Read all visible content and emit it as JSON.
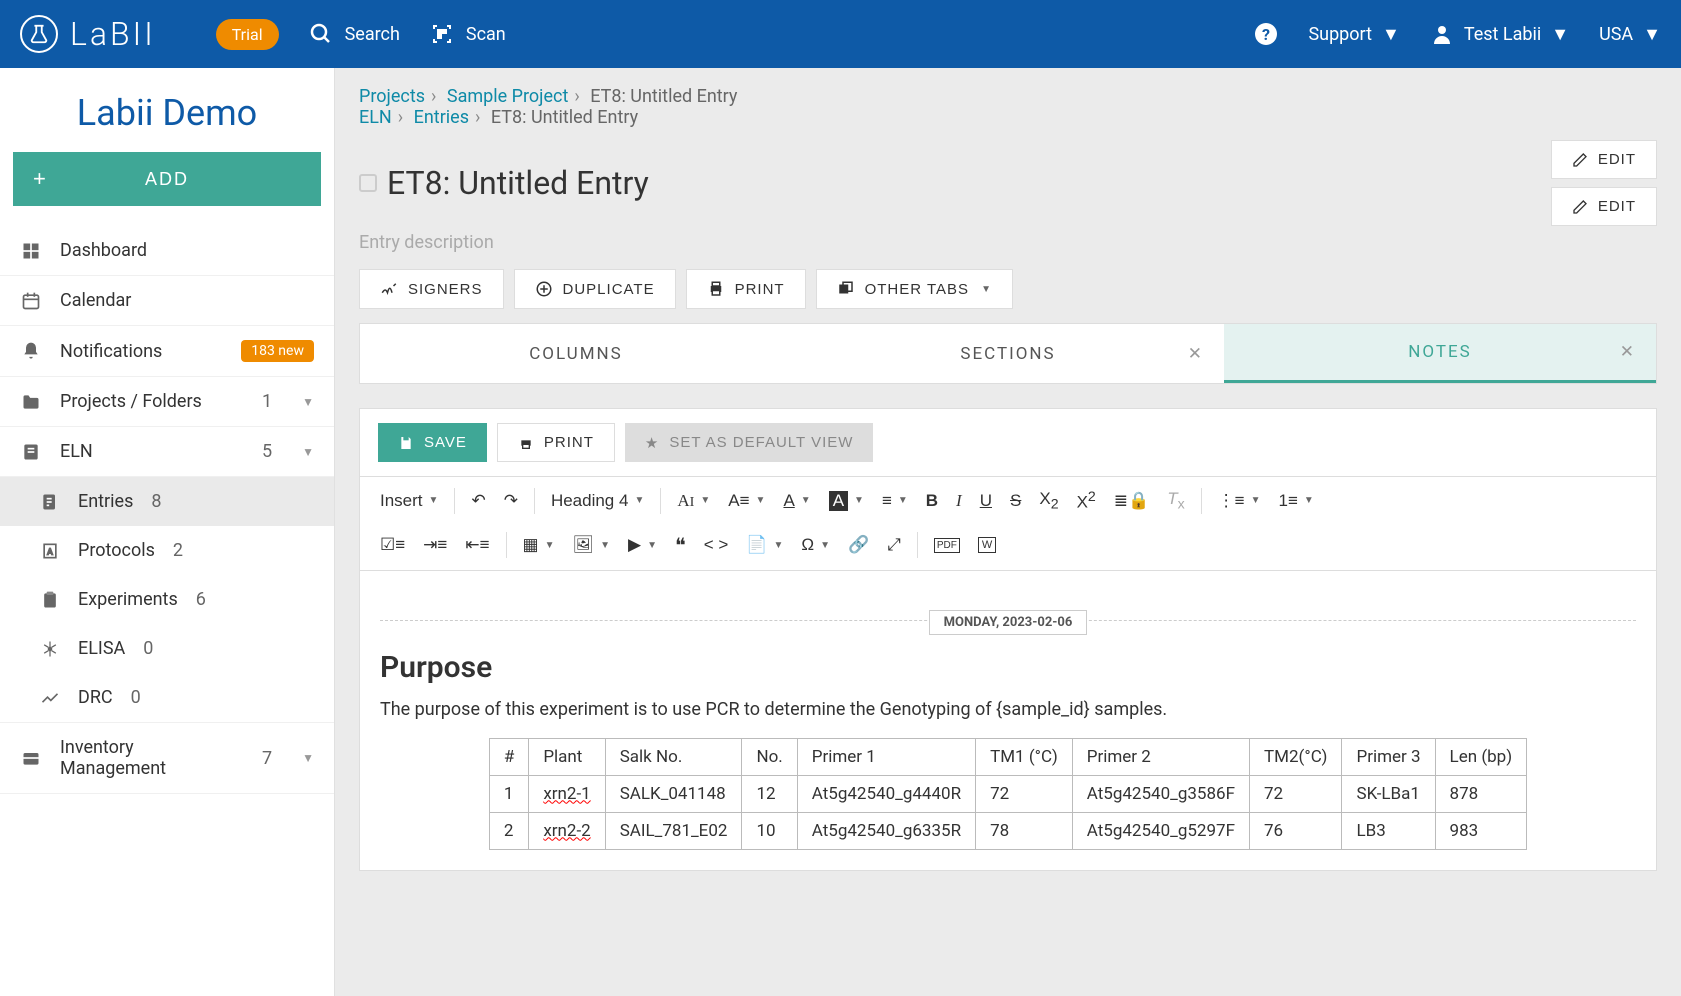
{
  "topbar": {
    "logo_text": "LaBII",
    "trial": "Trial",
    "search": "Search",
    "scan": "Scan",
    "support": "Support",
    "user": "Test Labii",
    "region": "USA"
  },
  "sidebar": {
    "org": "Labii Demo",
    "add": "ADD",
    "items": [
      {
        "label": "Dashboard",
        "icon": "dashboard"
      },
      {
        "label": "Calendar",
        "icon": "calendar"
      },
      {
        "label": "Notifications",
        "icon": "bell",
        "badge": "183 new"
      },
      {
        "label": "Projects / Folders",
        "icon": "folder",
        "count": "1",
        "expandable": true
      },
      {
        "label": "ELN",
        "icon": "note",
        "count": "5",
        "expandable": true,
        "expanded": true,
        "children": [
          {
            "label": "Entries",
            "count": "8",
            "active": true,
            "icon": "entries"
          },
          {
            "label": "Protocols",
            "count": "2",
            "icon": "protocols"
          },
          {
            "label": "Experiments",
            "count": "6",
            "icon": "clipboard"
          },
          {
            "label": "ELISA",
            "count": "0",
            "icon": "elisa"
          },
          {
            "label": "DRC",
            "count": "0",
            "icon": "chart"
          }
        ]
      },
      {
        "label": "Inventory Management",
        "icon": "inventory",
        "count": "7",
        "expandable": true
      }
    ]
  },
  "breadcrumbs": [
    {
      "path1_projects": "Projects",
      "path1_sample": "Sample Project",
      "path1_current": "ET8: Untitled Entry"
    },
    {
      "path2_eln": "ELN",
      "path2_entries": "Entries",
      "path2_current": "ET8: Untitled Entry"
    }
  ],
  "entry": {
    "title": "ET8: Untitled Entry",
    "description": "Entry description",
    "edit": "EDIT",
    "actions": {
      "signers": "SIGNERS",
      "duplicate": "DUPLICATE",
      "print": "PRINT",
      "other_tabs": "OTHER TABS"
    }
  },
  "tabs": {
    "columns": "COLUMNS",
    "sections": "SECTIONS",
    "notes": "NOTES"
  },
  "editor": {
    "save": "SAVE",
    "print": "PRINT",
    "set_default": "SET AS DEFAULT VIEW",
    "insert": "Insert",
    "heading": "Heading 4",
    "date_stamp": "MONDAY, 2023-02-06",
    "heading_text": "Purpose",
    "paragraph": "The purpose of this experiment is to use PCR to determine the Genotyping of {sample_id} samples.",
    "table_headers": [
      "#",
      "Plant",
      "Salk No.",
      "No.",
      "Primer 1",
      "TM1 (°C)",
      "Primer 2",
      "TM2(°C)",
      "Primer 3",
      "Len (bp)"
    ],
    "table_rows": [
      [
        "1",
        "xrn2-1",
        "SALK_041148",
        "12",
        "At5g42540_g4440R",
        "72",
        "At5g42540_g3586F",
        "72",
        "SK-LBa1",
        "878"
      ],
      [
        "2",
        "xrn2-2",
        "SAIL_781_E02",
        "10",
        "At5g42540_g6335R",
        "78",
        "At5g42540_g5297F",
        "76",
        "LB3",
        "983"
      ]
    ]
  }
}
